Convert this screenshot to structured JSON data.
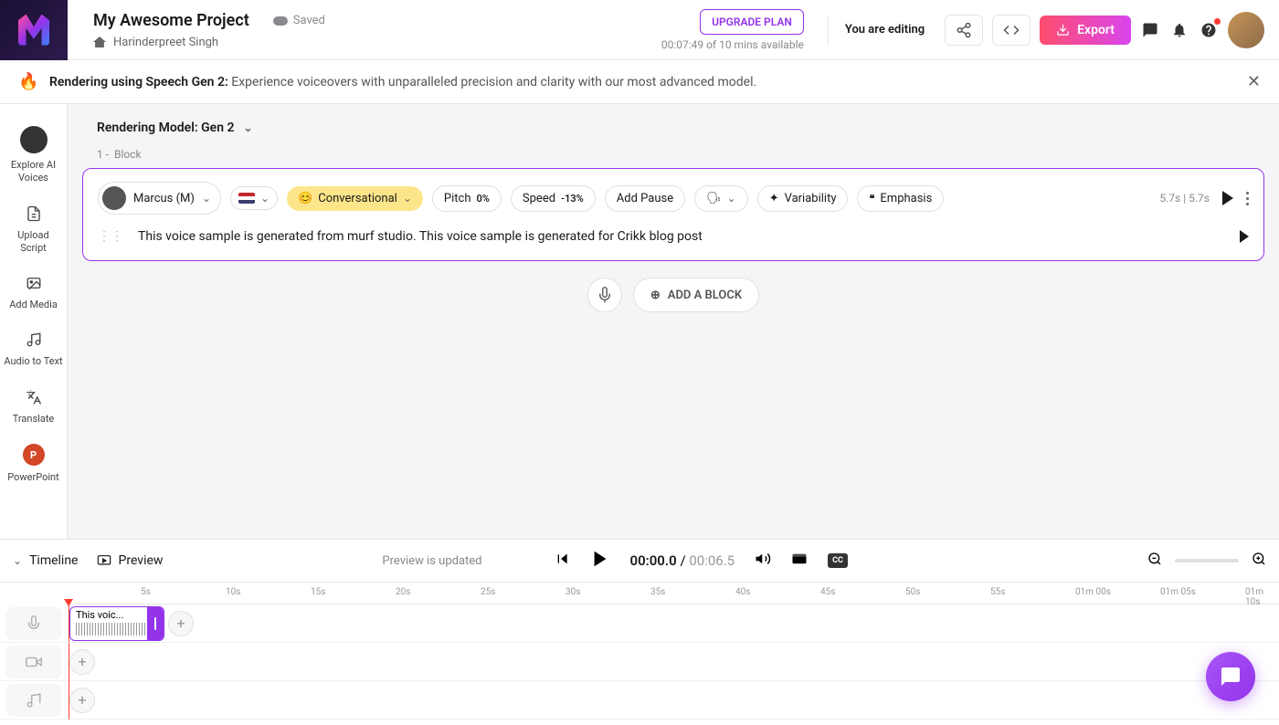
{
  "header": {
    "project_title": "My Awesome Project",
    "saved_label": "Saved",
    "owner": "Harinderpreet Singh",
    "upgrade": "UPGRADE PLAN",
    "time_remaining": "00:07:49 of 10 mins available",
    "editing": "You are editing",
    "export": "Export"
  },
  "banner": {
    "bold": "Rendering using Speech Gen 2: ",
    "text": "Experience voiceovers with unparalleled precision and clarity with our most advanced model."
  },
  "sidebar": {
    "items": [
      {
        "label": "Explore AI Voices"
      },
      {
        "label": "Upload Script"
      },
      {
        "label": "Add Media"
      },
      {
        "label": "Audio to Text"
      },
      {
        "label": "Translate"
      },
      {
        "label": "PowerPoint"
      }
    ]
  },
  "content": {
    "model_label": "Rendering Model: Gen 2",
    "block_number": "1 -",
    "block_word": "Block",
    "voice_name": "Marcus (M)",
    "style": "Conversational",
    "pitch_label": "Pitch",
    "pitch_val": "0%",
    "speed_label": "Speed",
    "speed_val": "-13%",
    "pause": "Add Pause",
    "variability": "Variability",
    "emphasis": "Emphasis",
    "dur1": "5.7s",
    "dur2": "5.7s",
    "text": "This voice sample is generated from murf studio. This voice sample is generated for Crikk blog post",
    "add_block": "ADD A BLOCK"
  },
  "timeline": {
    "tab1": "Timeline",
    "tab2": "Preview",
    "status": "Preview is updated",
    "time_cur": "00:00.0",
    "time_tot": "00:06.5",
    "ticks": [
      "5s",
      "10s",
      "15s",
      "20s",
      "25s",
      "30s",
      "35s",
      "40s",
      "45s",
      "50s",
      "55s",
      "01m 00s",
      "01m 05s",
      "01m 10s"
    ],
    "clip_text": "This voic..."
  }
}
